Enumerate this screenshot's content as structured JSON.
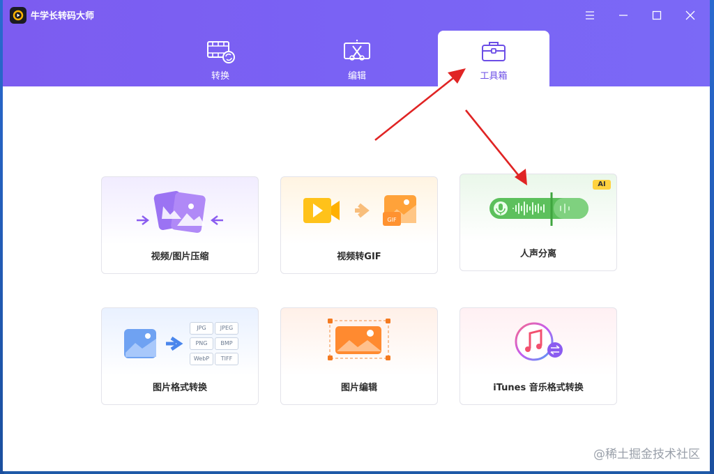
{
  "app": {
    "title": "牛学长转码大师"
  },
  "tabs": [
    {
      "label": "转换"
    },
    {
      "label": "编辑"
    },
    {
      "label": "工具箱"
    }
  ],
  "active_tab": "工具箱",
  "tools": [
    {
      "label": "视频/图片压缩"
    },
    {
      "label": "视频转GIF"
    },
    {
      "label": "人声分离",
      "badge": "AI"
    },
    {
      "label": "图片格式转换",
      "formats": [
        "JPG",
        "JPEG",
        "PNG",
        "BMP",
        "WebP",
        "TIFF"
      ]
    },
    {
      "label": "图片编辑"
    },
    {
      "label": "iTunes 音乐格式转换"
    }
  ],
  "gif_badge": "GIF",
  "watermark": "@稀土掘金技术社区",
  "colors": {
    "header": "#7b5ff2",
    "accent": "#6b4de6",
    "arrow": "#e02424"
  }
}
